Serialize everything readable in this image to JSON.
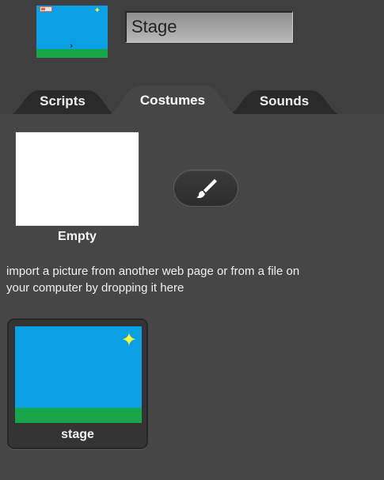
{
  "sprite_header": {
    "name_value": "Stage",
    "thumbnail_icon": "stage-thumbnail"
  },
  "tabs": [
    {
      "label": "Scripts",
      "active": false
    },
    {
      "label": "Costumes",
      "active": true
    },
    {
      "label": "Sounds",
      "active": false
    }
  ],
  "costumes_panel": {
    "new_costume_label": "Empty",
    "paint_button_icon": "paintbrush-icon",
    "import_hint": "import a picture from another web page or from a file on your computer by dropping it here",
    "costumes": [
      {
        "name": "stage",
        "icon": "star-icon"
      }
    ]
  },
  "colors": {
    "sky": "#0aa0e3",
    "ground": "#19a64b",
    "star": "#ffff3a",
    "panel_bg": "#464646",
    "header_bg": "#3f3f3f"
  }
}
